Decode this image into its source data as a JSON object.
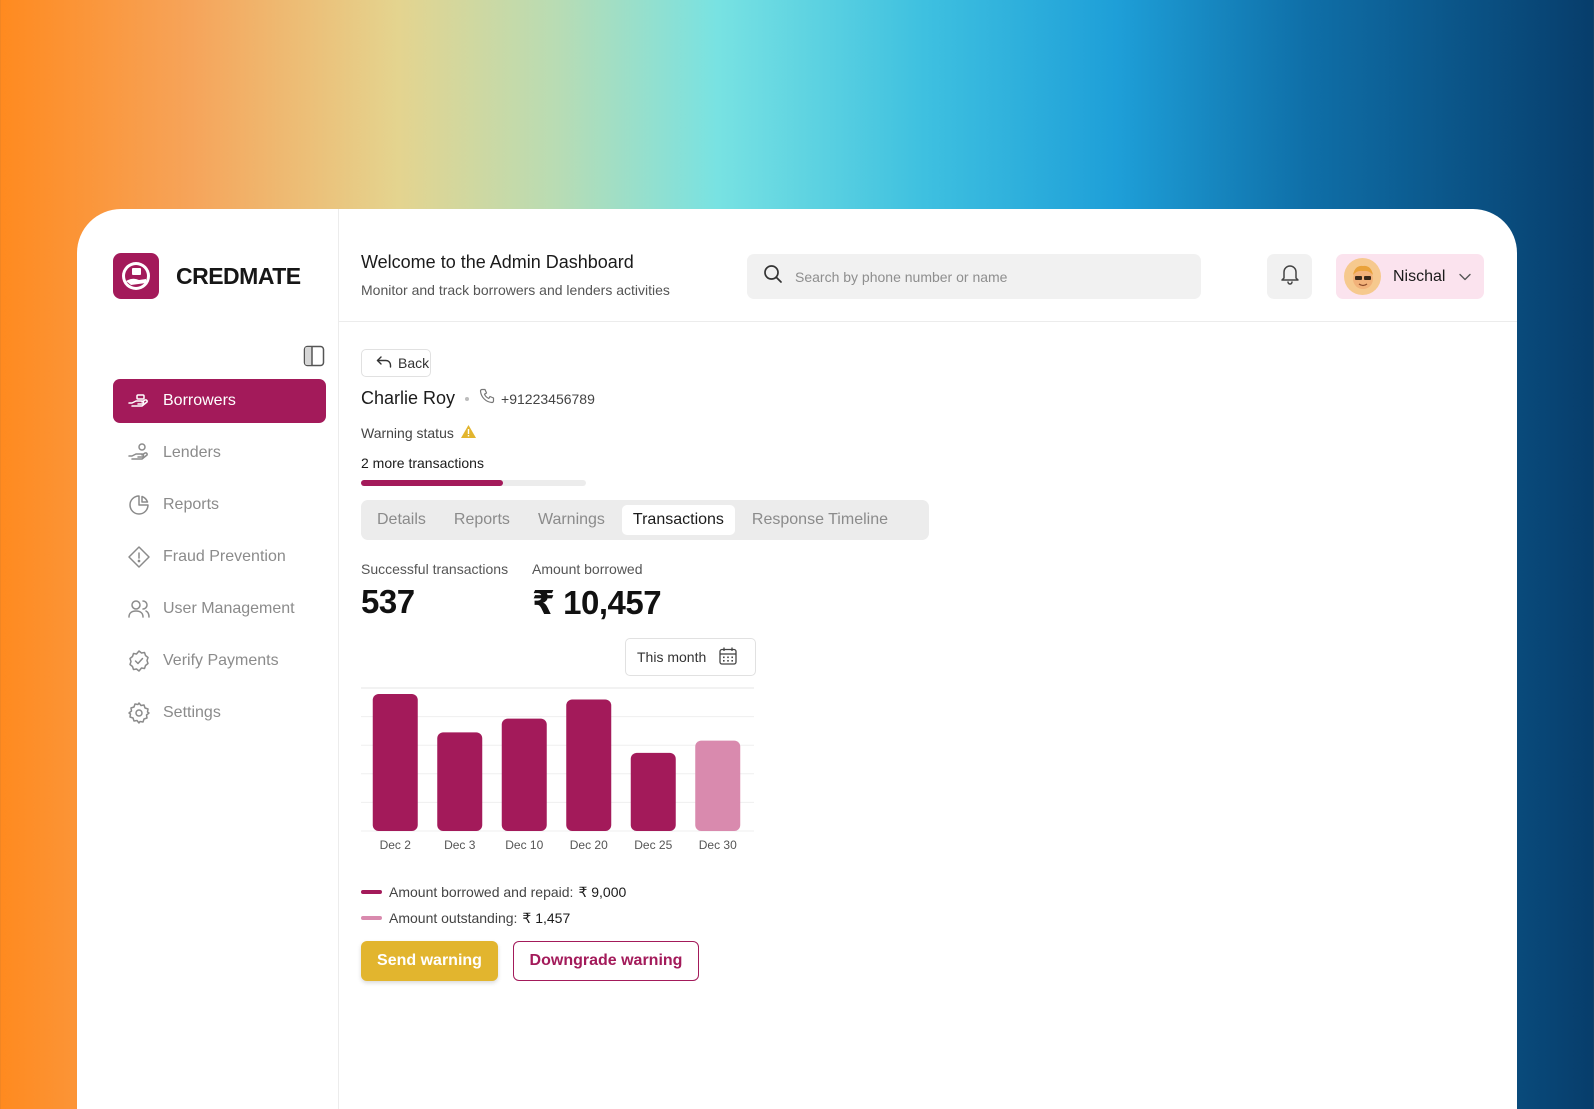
{
  "brand": {
    "name": "CREDMATE",
    "color": "#a31a5a"
  },
  "sidebar": {
    "items": [
      {
        "label": "Borrowers",
        "icon": "hand-money-icon",
        "active": true
      },
      {
        "label": "Lenders",
        "icon": "hand-coins-icon",
        "active": false
      },
      {
        "label": "Reports",
        "icon": "pie-chart-icon",
        "active": false
      },
      {
        "label": "Fraud Prevention",
        "icon": "alert-diamond-icon",
        "active": false
      },
      {
        "label": "User Management",
        "icon": "users-icon",
        "active": false
      },
      {
        "label": "Verify Payments",
        "icon": "badge-check-icon",
        "active": false
      },
      {
        "label": "Settings",
        "icon": "gear-icon",
        "active": false
      }
    ]
  },
  "header": {
    "title": "Welcome to the Admin Dashboard",
    "subtitle": "Monitor and track borrowers and lenders activities",
    "search_placeholder": "Search by phone number or name",
    "user_name": "Nischal"
  },
  "borrower": {
    "back_label": "Back",
    "name": "Charlie Roy",
    "phone": "+91223456789",
    "warning_label": "Warning status",
    "more_transactions": "2 more transactions",
    "progress": 0.63
  },
  "tabs": [
    {
      "label": "Details",
      "active": false
    },
    {
      "label": "Reports",
      "active": false
    },
    {
      "label": "Warnings",
      "active": false
    },
    {
      "label": "Transactions",
      "active": true
    },
    {
      "label": "Response Timeline",
      "active": false
    }
  ],
  "stats": {
    "successful_label": "Successful transactions",
    "successful_value": "537",
    "borrowed_label": "Amount borrowed",
    "borrowed_value": "₹ 10,457"
  },
  "period": {
    "label": "This month"
  },
  "chart_data": {
    "type": "bar",
    "categories": [
      "Dec 2",
      "Dec 3",
      "Dec 10",
      "Dec 20",
      "Dec 25",
      "Dec 30"
    ],
    "values": [
      100,
      72,
      82,
      96,
      57,
      66
    ],
    "ylim": [
      0,
      100
    ],
    "grid": true,
    "bar_series": [
      "repaid",
      "repaid",
      "repaid",
      "repaid",
      "repaid",
      "outstanding"
    ],
    "colors": {
      "repaid": "#a31a5a",
      "outstanding": "#d98aae"
    },
    "legend": [
      {
        "key": "repaid",
        "label": "Amount borrowed and repaid:",
        "value": "₹ 9,000"
      },
      {
        "key": "outstanding",
        "label": "Amount outstanding:",
        "value": "₹ 1,457"
      }
    ]
  },
  "actions": {
    "send_warning": "Send warning",
    "downgrade_warning": "Downgrade warning",
    "send_color": "#e2b52e"
  }
}
